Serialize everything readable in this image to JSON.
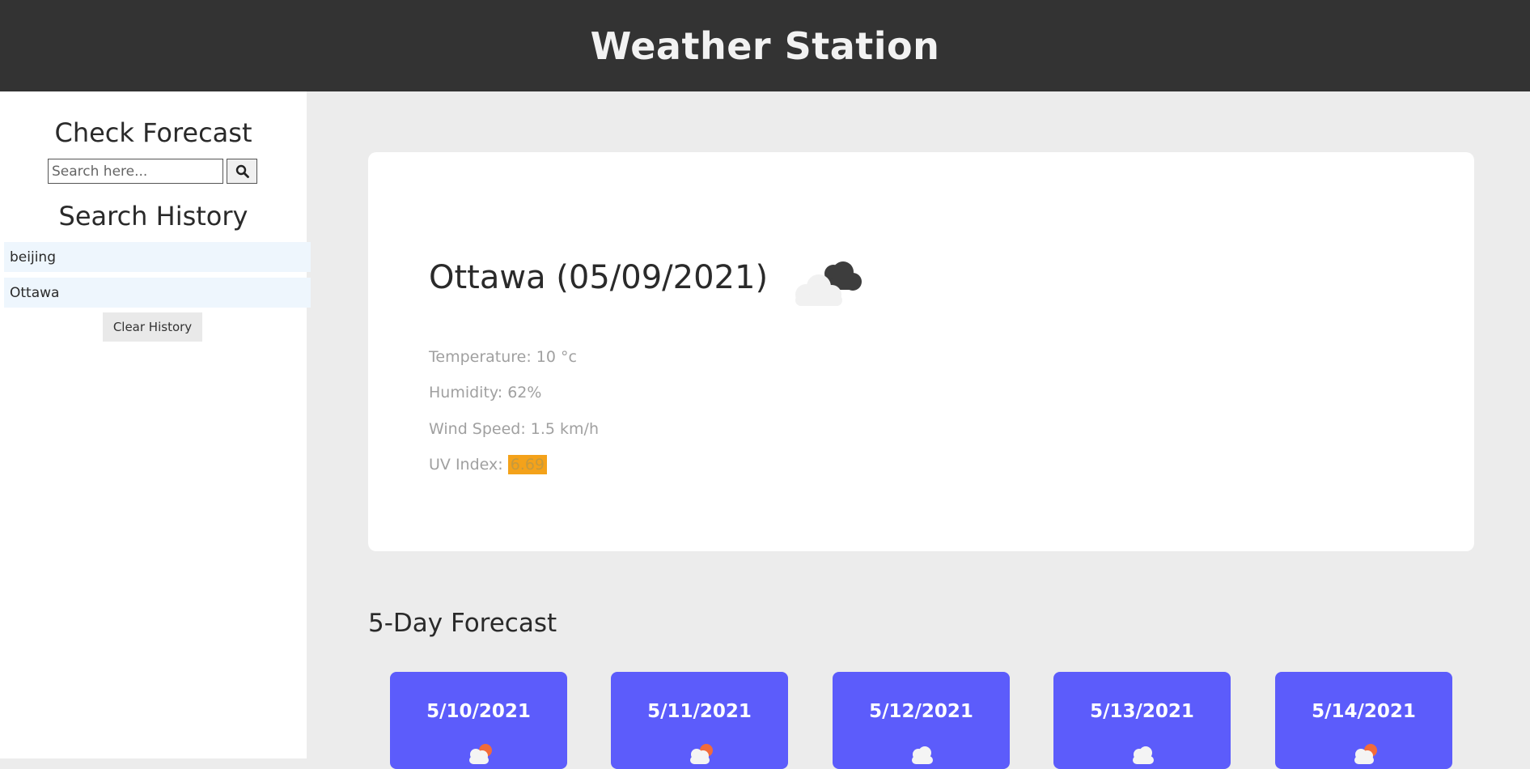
{
  "header": {
    "title": "Weather Station"
  },
  "sidebar": {
    "check_title": "Check Forecast",
    "search": {
      "placeholder": "Search here...",
      "value": ""
    },
    "search_button_icon": "search-icon",
    "history_title": "Search History",
    "history": [
      "beijing",
      "Ottawa"
    ],
    "clear_label": "Clear History"
  },
  "current": {
    "city_title": "Ottawa (05/09/2021)",
    "icon": "night-cloudy-icon",
    "temperature": "Temperature: 10 °c",
    "humidity": "Humidity: 62%",
    "wind": "Wind Speed: 1.5 km/h",
    "uv_label": "UV Index: ",
    "uv_value": "6.69",
    "uv_color": "#f4a21a"
  },
  "forecast": {
    "title": "5-Day Forecast",
    "card_color": "#5c5cfb",
    "days": [
      {
        "date": "5/10/2021",
        "icon": "day-cloudy-icon"
      },
      {
        "date": "5/11/2021",
        "icon": "day-cloudy-icon"
      },
      {
        "date": "5/12/2021",
        "icon": "cloud-icon"
      },
      {
        "date": "5/13/2021",
        "icon": "cloud-icon"
      },
      {
        "date": "5/14/2021",
        "icon": "day-cloudy-icon"
      }
    ]
  }
}
